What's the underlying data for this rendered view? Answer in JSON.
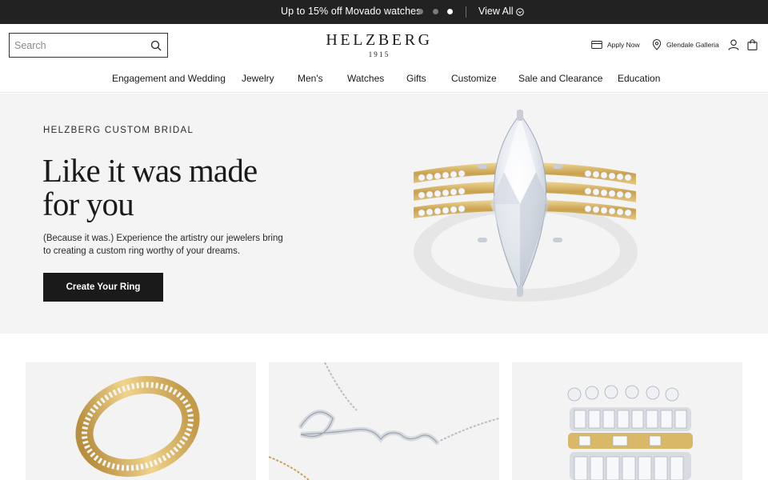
{
  "promo": {
    "text": "Up to 15% off Movado watches",
    "view_all": "View All",
    "slide_dots": 3,
    "active_slide": 3
  },
  "header": {
    "search_placeholder": "Search",
    "logo": {
      "word": "HELZBERG",
      "year": "1915"
    },
    "apply_now": "Apply Now",
    "store": "Glendale Galleria"
  },
  "nav": {
    "items": [
      "Engagement and Wedding",
      "Jewelry",
      "Men's",
      "Watches",
      "Gifts",
      "Customize",
      "Sale and Clearance",
      "Education"
    ]
  },
  "hero": {
    "eyebrow": "HELZBERG CUSTOM BRIDAL",
    "headline_line1": "Like it was made",
    "headline_line2": "for you",
    "subcopy": "(Because it was.) Experience the artistry our jewelers bring to creating a custom ring worthy of your dreams.",
    "cta": "Create Your Ring"
  },
  "colors": {
    "promo_bg": "#222222",
    "hero_bg": "#f4f4f4",
    "cta_bg": "#1a1a1a",
    "tile_bg": "#f3f3f3",
    "gold": "#d4b36a"
  }
}
